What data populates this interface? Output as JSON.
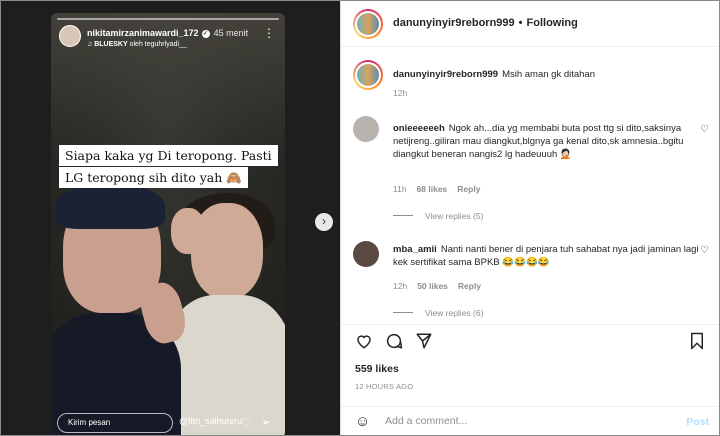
{
  "story": {
    "username": "nikitamirzanimawardi_172",
    "time": "45 menit",
    "music_title": "BLUESKY",
    "music_artist": "oleh teguhrlyadi__",
    "caption_lines": [
      "Siapa kaka yg Di teropong. Pasti",
      "LG teropong sih dito yah 🙈"
    ],
    "reply_placeholder": "Kirim pesan",
    "tag": "@fitri_salhuteru"
  },
  "post": {
    "author": "danunyinyir9reborn999",
    "follow_status": "Following",
    "caption": "Msih aman gk ditahan",
    "caption_time": "12h"
  },
  "comments": [
    {
      "user": "onieeeeeeh",
      "text": "Ngok ah...dia yg membabi buta post ttg si dito,saksinya netijreng..giliran mau diangkut,blgnya ga kenal dito,sk amnesia..bgitu diangkut beneran nangis2 lg hadeuuuh 🤦🏻",
      "time": "11h",
      "likes": "68 likes",
      "reply": "Reply",
      "view_replies": "View replies (5)"
    },
    {
      "user": "mba_amii",
      "text": "Nanti nanti bener di penjara tuh sahabat nya jadi jaminan lagi kek sertifikat sama BPKB 😂😂😂😂",
      "time": "12h",
      "likes": "50 likes",
      "reply": "Reply",
      "view_replies": "View replies (6)"
    }
  ],
  "actions": {
    "like_icon": "heart-icon",
    "comment_icon": "comment-icon",
    "share_icon": "share-icon",
    "save_icon": "bookmark-icon"
  },
  "likes": "559 likes",
  "date": "12 HOURS AGO",
  "add_comment": {
    "placeholder": "Add a comment...",
    "post_label": "Post"
  }
}
